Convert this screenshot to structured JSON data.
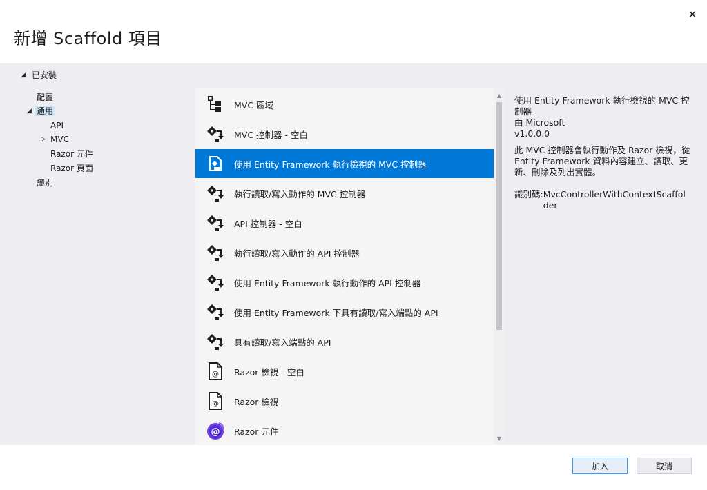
{
  "dialog": {
    "title": "新增 Scaffold 項目",
    "close_glyph": "✕"
  },
  "tree": {
    "installed_label": "已安裝",
    "items": [
      {
        "label": "配置"
      },
      {
        "label": "通用"
      },
      {
        "label": "API"
      },
      {
        "label": "MVC"
      },
      {
        "label": "Razor 元件"
      },
      {
        "label": "Razor 頁面"
      },
      {
        "label": "識別"
      }
    ]
  },
  "list": {
    "items": [
      {
        "label": "MVC 區域",
        "icon": "area-tree-icon"
      },
      {
        "label": "MVC 控制器 - 空白",
        "icon": "controller-icon"
      },
      {
        "label": "使用 Entity Framework 執行檢視的 MVC 控制器",
        "icon": "controller-ef-icon",
        "selected": true
      },
      {
        "label": "執行讀取/寫入動作的 MVC 控制器",
        "icon": "controller-icon"
      },
      {
        "label": "API 控制器 - 空白",
        "icon": "controller-icon"
      },
      {
        "label": "執行讀取/寫入動作的 API 控制器",
        "icon": "controller-icon"
      },
      {
        "label": "使用 Entity Framework 執行動作的 API 控制器",
        "icon": "controller-icon"
      },
      {
        "label": "使用 Entity Framework 下具有讀取/寫入端點的 API",
        "icon": "controller-icon"
      },
      {
        "label": "具有讀取/寫入端點的 API",
        "icon": "controller-icon"
      },
      {
        "label": "Razor 檢視 - 空白",
        "icon": "razor-view-icon"
      },
      {
        "label": "Razor 檢視",
        "icon": "razor-view-icon"
      },
      {
        "label": "Razor 元件",
        "icon": "blazor-icon"
      }
    ]
  },
  "details": {
    "title": "使用 Entity Framework 執行檢視的 MVC 控制器",
    "author": "由 Microsoft",
    "version": "v1.0.0.0",
    "description": "此 MVC 控制器會執行動作及 Razor 檢視，從 Entity Framework 資料內容建立、讀取、更新、刪除及列出實體。",
    "id_label": "識別碼: ",
    "id_value": "MvcControllerWithContextScaffolder"
  },
  "buttons": {
    "add": "加入",
    "cancel": "取消"
  },
  "colors": {
    "selection": "#0078d7",
    "panel_bg": "#eeeef2",
    "list_bg": "#f5f5f5",
    "blazor_purple": "#512bd4"
  }
}
